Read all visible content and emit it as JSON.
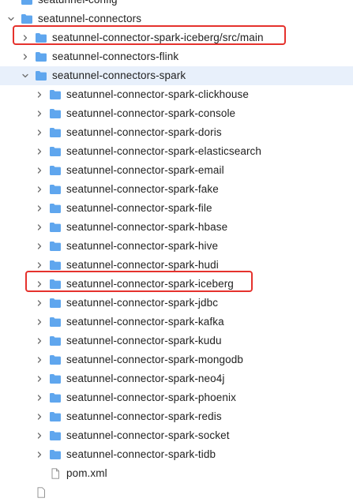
{
  "tree": {
    "partial_top_label": "seatunnel-config",
    "connectors_label": "seatunnel-connectors",
    "iceberg_main_label": "seatunnel-connector-spark-iceberg/src/main",
    "flink_label": "seatunnel-connectors-flink",
    "spark_label": "seatunnel-connectors-spark",
    "spark_children": [
      "seatunnel-connector-spark-clickhouse",
      "seatunnel-connector-spark-console",
      "seatunnel-connector-spark-doris",
      "seatunnel-connector-spark-elasticsearch",
      "seatunnel-connector-spark-email",
      "seatunnel-connector-spark-fake",
      "seatunnel-connector-spark-file",
      "seatunnel-connector-spark-hbase",
      "seatunnel-connector-spark-hive",
      "seatunnel-connector-spark-hudi",
      "seatunnel-connector-spark-iceberg",
      "seatunnel-connector-spark-jdbc",
      "seatunnel-connector-spark-kafka",
      "seatunnel-connector-spark-kudu",
      "seatunnel-connector-spark-mongodb",
      "seatunnel-connector-spark-neo4j",
      "seatunnel-connector-spark-phoenix",
      "seatunnel-connector-spark-redis",
      "seatunnel-connector-spark-socket",
      "seatunnel-connector-spark-tidb"
    ],
    "pom_label": "pom.xml"
  },
  "colors": {
    "folder": "#5fa6ee",
    "highlight_border": "#e5322d",
    "selected_row": "#e8f0fb",
    "arrow": "#6e6e6e"
  },
  "icons": {
    "folder": "folder-icon",
    "file": "file-icon",
    "collapsed": "chevron-right-icon",
    "expanded": "chevron-down-icon"
  }
}
